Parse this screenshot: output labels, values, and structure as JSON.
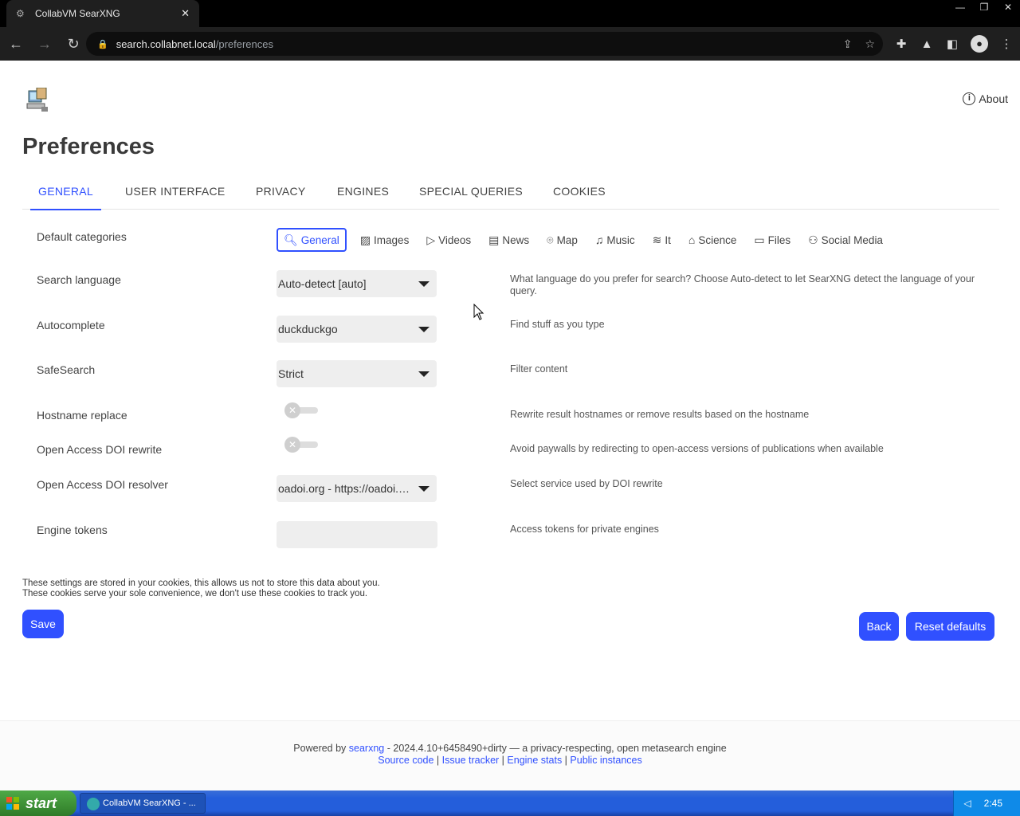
{
  "browser": {
    "tab_title": "CollabVM SearXNG",
    "tab_close": "✕",
    "window_controls": [
      "—",
      "❐",
      "✕"
    ],
    "url_host": "search.collabnet.local",
    "url_path": "/preferences"
  },
  "header": {
    "about_label": "About"
  },
  "page_title": "Preferences",
  "tabs": [
    {
      "label": "GENERAL",
      "active": true
    },
    {
      "label": "USER INTERFACE",
      "active": false
    },
    {
      "label": "PRIVACY",
      "active": false
    },
    {
      "label": "ENGINES",
      "active": false
    },
    {
      "label": "SPECIAL QUERIES",
      "active": false
    },
    {
      "label": "COOKIES",
      "active": false
    }
  ],
  "settings": {
    "default_categories": {
      "label": "Default categories",
      "items": [
        {
          "label": "General",
          "icon": "search-icon",
          "selected": true
        },
        {
          "label": "Images",
          "icon": "image-icon",
          "selected": false
        },
        {
          "label": "Videos",
          "icon": "play-icon",
          "selected": false
        },
        {
          "label": "News",
          "icon": "newspaper-icon",
          "selected": false
        },
        {
          "label": "Map",
          "icon": "map-pin-icon",
          "selected": false
        },
        {
          "label": "Music",
          "icon": "music-note-icon",
          "selected": false
        },
        {
          "label": "It",
          "icon": "layers-icon",
          "selected": false
        },
        {
          "label": "Science",
          "icon": "graduation-cap-icon",
          "selected": false
        },
        {
          "label": "Files",
          "icon": "archive-icon",
          "selected": false
        },
        {
          "label": "Social Media",
          "icon": "people-icon",
          "selected": false
        }
      ]
    },
    "search_language": {
      "label": "Search language",
      "value": "Auto-detect [auto]",
      "description": "What language do you prefer for search? Choose Auto-detect to let SearXNG detect the language of your query."
    },
    "autocomplete": {
      "label": "Autocomplete",
      "value": "duckduckgo",
      "description": "Find stuff as you type"
    },
    "safesearch": {
      "label": "SafeSearch",
      "value": "Strict",
      "description": "Filter content"
    },
    "hostname_replace": {
      "label": "Hostname replace",
      "enabled": false,
      "description": "Rewrite result hostnames or remove results based on the hostname"
    },
    "doi_rewrite": {
      "label": "Open Access DOI rewrite",
      "enabled": false,
      "description": "Avoid paywalls by redirecting to open-access versions of publications when available"
    },
    "doi_resolver": {
      "label": "Open Access DOI resolver",
      "value": "oadoi.org - https://oadoi.org/",
      "description": "Select service used by DOI rewrite"
    },
    "engine_tokens": {
      "label": "Engine tokens",
      "value": "",
      "description": "Access tokens for private engines"
    }
  },
  "cookie_note": {
    "line1": "These settings are stored in your cookies, this allows us not to store this data about you.",
    "line2": "These cookies serve your sole convenience, we don't use these cookies to track you."
  },
  "buttons": {
    "save": "Save",
    "back": "Back",
    "reset": "Reset defaults"
  },
  "footer": {
    "powered_prefix": "Powered by ",
    "searxng_link": "searxng",
    "powered_suffix": " - 2024.4.10+6458490+dirty — a privacy-respecting, open metasearch engine",
    "links": [
      "Source code",
      "Issue tracker",
      "Engine stats",
      "Public instances"
    ],
    "separator": " | "
  },
  "taskbar": {
    "start_label": "start",
    "task_label": "CollabVM SearXNG - ...",
    "clock": "2:45"
  },
  "colors": {
    "accent": "#3050ff",
    "chrome_bg": "#1f1f1f",
    "taskbar": "#245edb"
  }
}
